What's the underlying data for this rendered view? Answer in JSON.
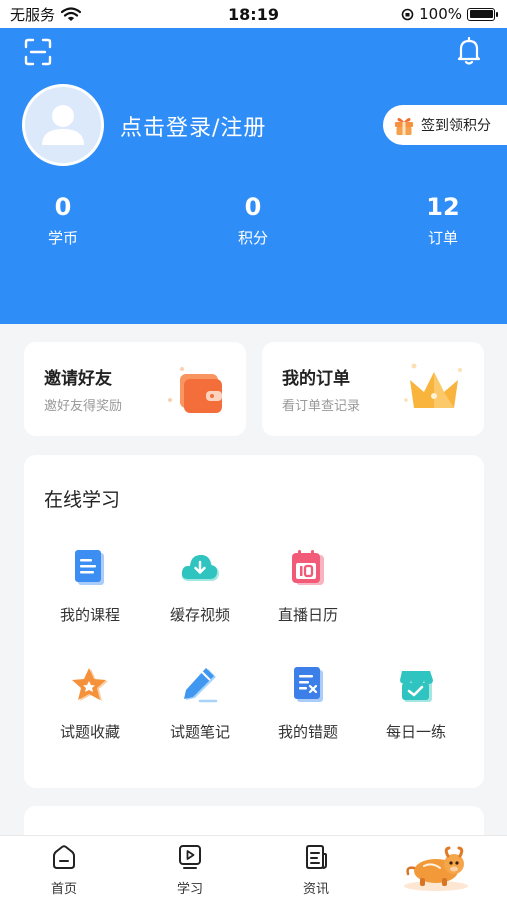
{
  "status_bar": {
    "carrier": "无服务",
    "time": "18:19",
    "battery_percent": "100%"
  },
  "header": {
    "login_text": "点击登录/注册",
    "checkin_label": "签到领积分",
    "stats": [
      {
        "value": "0",
        "label": "学币"
      },
      {
        "value": "0",
        "label": "积分"
      },
      {
        "value": "12",
        "label": "订单"
      }
    ]
  },
  "promo": {
    "invite": {
      "title": "邀请好友",
      "subtitle": "邀好友得奖励"
    },
    "orders": {
      "title": "我的订单",
      "subtitle": "看订单查记录"
    }
  },
  "learning": {
    "title": "在线学习",
    "items": [
      {
        "label": "我的课程",
        "icon": "document-icon"
      },
      {
        "label": "缓存视频",
        "icon": "cloud-download-icon"
      },
      {
        "label": "直播日历",
        "icon": "calendar-icon"
      },
      {
        "label": "试题收藏",
        "icon": "star-icon"
      },
      {
        "label": "试题笔记",
        "icon": "pencil-icon"
      },
      {
        "label": "我的错题",
        "icon": "wrong-list-icon"
      },
      {
        "label": "每日一练",
        "icon": "store-check-icon"
      }
    ]
  },
  "tabs": [
    {
      "label": "首页",
      "icon": "home-icon"
    },
    {
      "label": "学习",
      "icon": "play-icon"
    },
    {
      "label": "资讯",
      "icon": "news-icon"
    }
  ],
  "colors": {
    "header_blue": "#2f8df8",
    "accent_orange": "#f5a33c"
  }
}
